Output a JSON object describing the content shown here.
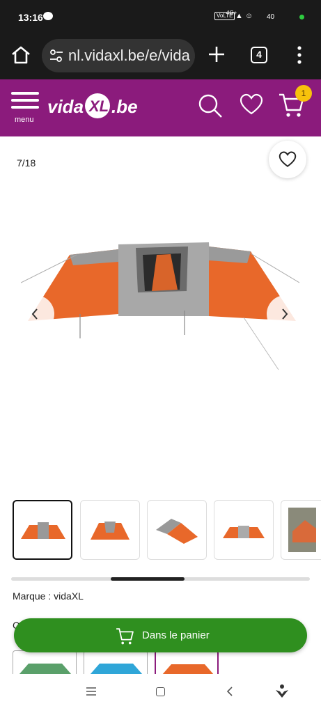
{
  "status_bar": {
    "time": "13:16",
    "network": "VoLTE",
    "signal": "4G+",
    "level": "40"
  },
  "browser": {
    "url": "nl.vidaxl.be/e/vida",
    "tabs_count": "4"
  },
  "header": {
    "menu_label": "menu",
    "logo_text": "vidaXL.be",
    "cart_count": "1",
    "brand_color": "#8b1b7c"
  },
  "gallery": {
    "counter": "7/18"
  },
  "product": {
    "brand_line": "Marque : vidaXL",
    "section_initial": "C"
  },
  "cart_button": {
    "label": "Dans le panier",
    "color": "#2f8f1f"
  },
  "icons": [
    "home-icon",
    "tune-icon",
    "plus-icon",
    "more-icon",
    "search-icon",
    "heart-icon",
    "cart-icon",
    "chevron-left-icon",
    "chevron-right-icon"
  ]
}
